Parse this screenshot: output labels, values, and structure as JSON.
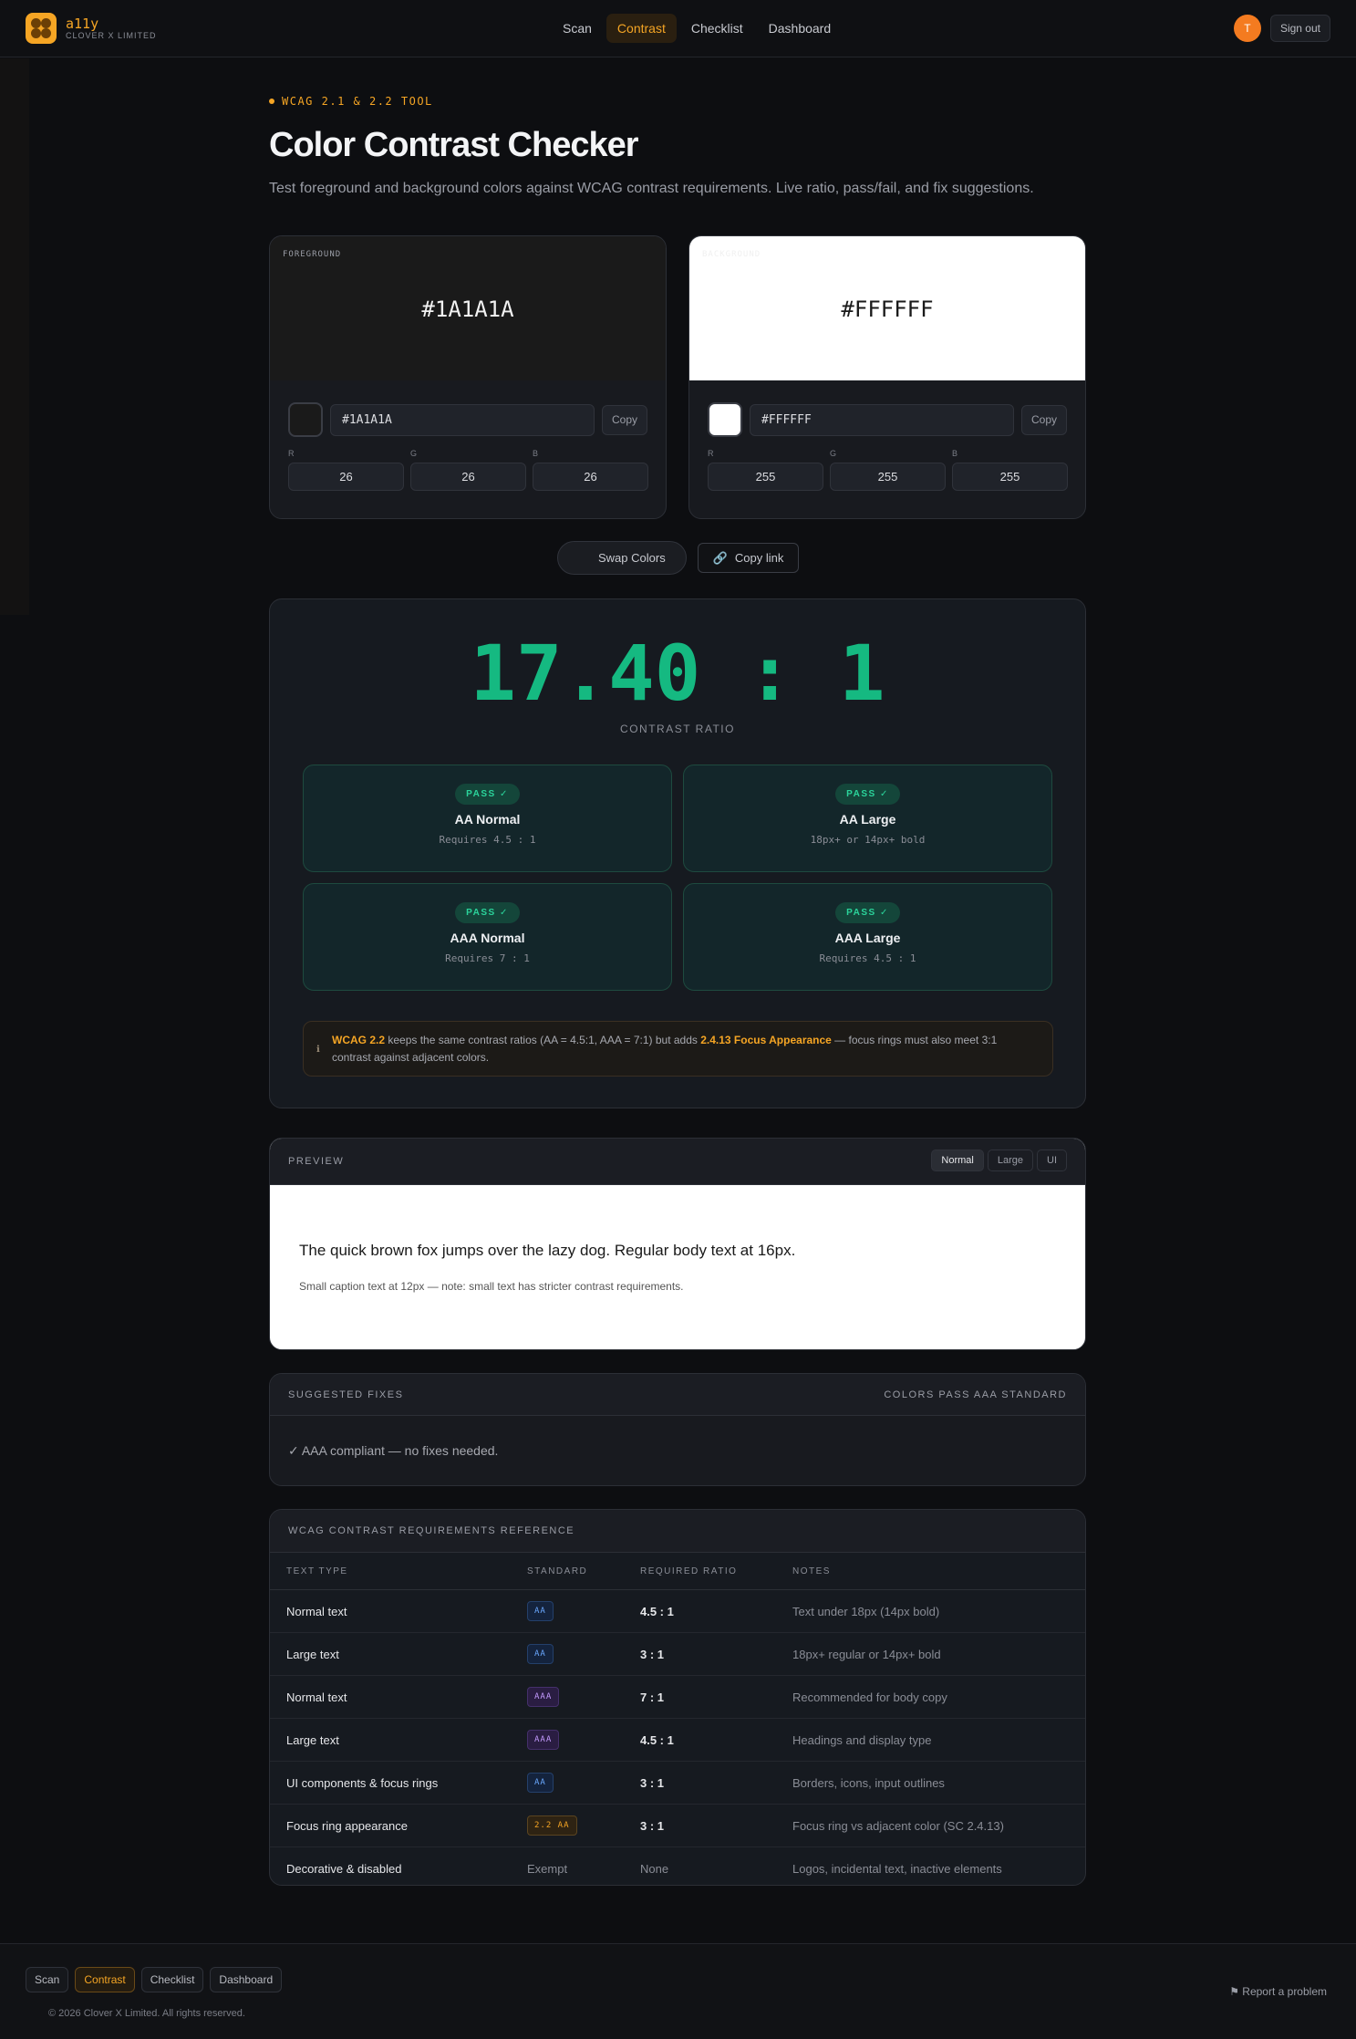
{
  "brand": {
    "name": "a11y",
    "subtitle": "CLOVER X LIMITED"
  },
  "nav": {
    "items": [
      "Scan",
      "Contrast",
      "Checklist",
      "Dashboard"
    ],
    "active": "Contrast"
  },
  "user": {
    "avatar_initial": "T",
    "sign_out_label": "Sign out"
  },
  "header": {
    "eyebrow": "WCAG 2.1 & 2.2 TOOL",
    "title": "Color Contrast Checker",
    "subtitle": "Test foreground and background colors against WCAG contrast requirements. Live ratio, pass/fail, and fix suggestions."
  },
  "foreground": {
    "label": "FOREGROUND",
    "hex": "#1A1A1A",
    "r": "26",
    "g": "26",
    "b": "26",
    "copy_label": "Copy",
    "color": "#1a1a1a"
  },
  "background": {
    "label": "BACKGROUND",
    "hex": "#FFFFFF",
    "r": "255",
    "g": "255",
    "b": "255",
    "copy_label": "Copy",
    "color": "#ffffff"
  },
  "channel_labels": {
    "r": "R",
    "g": "G",
    "b": "B"
  },
  "actions": {
    "swap_label": "Swap Colors",
    "copy_link_label": "Copy link"
  },
  "result": {
    "ratio": "17.40 : 1",
    "ratio_label": "CONTRAST RATIO",
    "levels": [
      {
        "badge": "PASS ✓",
        "name": "AA Normal",
        "requirement": "Requires 4.5 : 1"
      },
      {
        "badge": "PASS ✓",
        "name": "AA Large",
        "requirement": "18px+ or 14px+ bold"
      },
      {
        "badge": "PASS ✓",
        "name": "AAA Normal",
        "requirement": "Requires 7 : 1"
      },
      {
        "badge": "PASS ✓",
        "name": "AAA Large",
        "requirement": "Requires 4.5 : 1"
      }
    ],
    "note": {
      "lead": "WCAG 2.2",
      "text1": " keeps the same contrast ratios (AA = 4.5:1, AAA = 7:1) but adds ",
      "highlight": "2.4.13 Focus Appearance",
      "text2": " — focus rings must also meet 3:1 contrast against adjacent colors."
    }
  },
  "preview": {
    "title": "PREVIEW",
    "modes": [
      "Normal",
      "Large",
      "UI"
    ],
    "active_mode": "Normal",
    "main_text": "The quick brown fox jumps over the lazy dog. Regular body text at 16px.",
    "small_text": "Small caption text at 12px — note: small text has stricter contrast requirements."
  },
  "fixes": {
    "title": "SUGGESTED FIXES",
    "status": "COLORS PASS AAA STANDARD",
    "message": "✓ AAA compliant — no fixes needed."
  },
  "reference": {
    "title": "WCAG CONTRAST REQUIREMENTS REFERENCE",
    "columns": [
      "TEXT TYPE",
      "STANDARD",
      "REQUIRED RATIO",
      "NOTES"
    ],
    "rows": [
      {
        "type": "Normal text",
        "standard": "AA",
        "kind": "aa",
        "ratio": "4.5 : 1",
        "notes": "Text under 18px (14px bold)"
      },
      {
        "type": "Large text",
        "standard": "AA",
        "kind": "aa",
        "ratio": "3 : 1",
        "notes": "18px+ regular or 14px+ bold"
      },
      {
        "type": "Normal text",
        "standard": "AAA",
        "kind": "aaa",
        "ratio": "7 : 1",
        "notes": "Recommended for body copy"
      },
      {
        "type": "Large text",
        "standard": "AAA",
        "kind": "aaa",
        "ratio": "4.5 : 1",
        "notes": "Headings and display type"
      },
      {
        "type": "UI components & focus rings",
        "standard": "AA",
        "kind": "aa",
        "ratio": "3 : 1",
        "notes": "Borders, icons, input outlines"
      },
      {
        "type": "Focus ring appearance",
        "standard": "2.2 AA",
        "kind": "v22",
        "ratio": "3 : 1",
        "notes": "Focus ring vs adjacent color (SC 2.4.13)"
      },
      {
        "type": "Decorative & disabled",
        "standard": "Exempt",
        "kind": "plain",
        "ratio": "None",
        "notes": "Logos, incidental text, inactive elements"
      }
    ]
  },
  "footer": {
    "nav": [
      "Scan",
      "Contrast",
      "Checklist",
      "Dashboard"
    ],
    "active": "Contrast",
    "copyright": "© 2026 Clover X Limited. All rights reserved.",
    "report_label": "⚑ Report a problem"
  }
}
